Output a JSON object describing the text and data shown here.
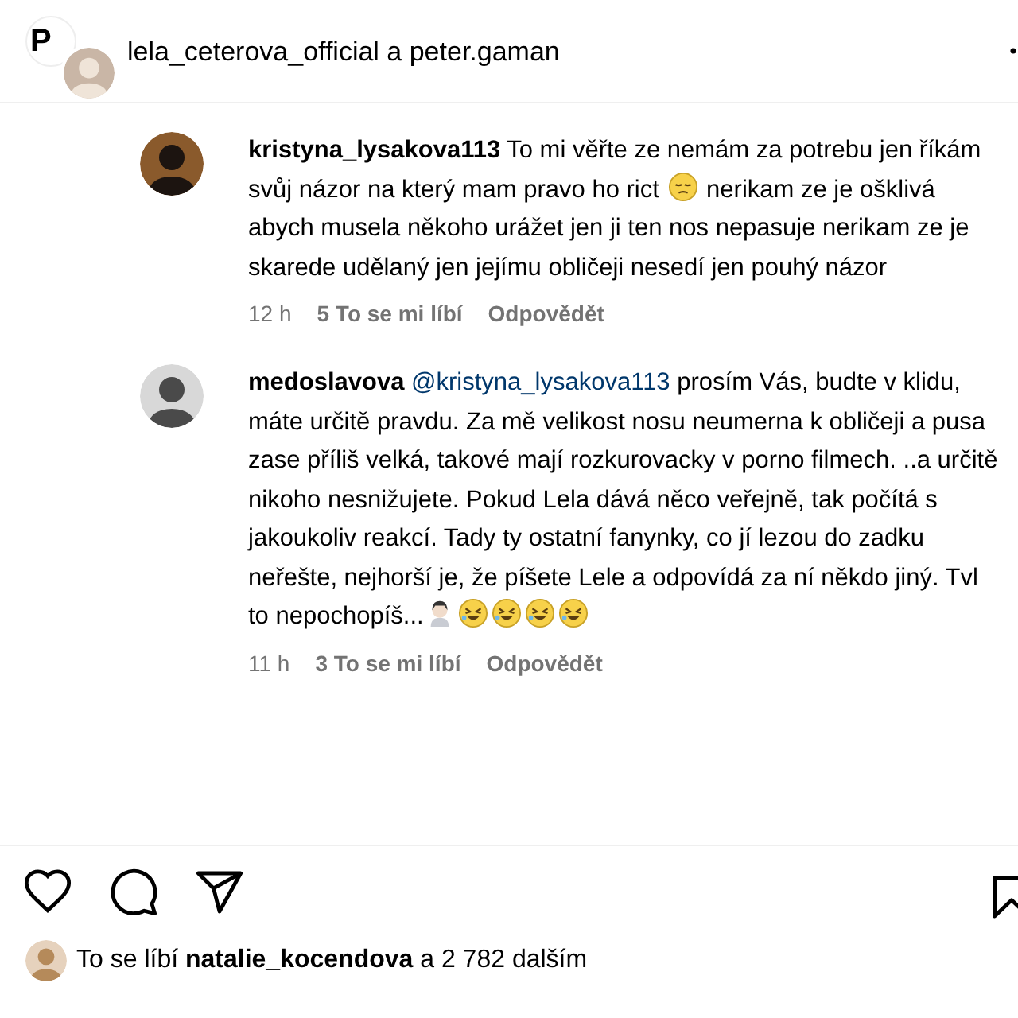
{
  "header": {
    "logo_text": "P",
    "title": "lela_ceterova_official a peter.gaman"
  },
  "comments": [
    {
      "username": "kristyna_lysakova113",
      "segments": [
        {
          "kind": "text",
          "text": "To mi věřte ze nemám za potrebu jen říkám svůj názor na který mam pravo ho rict "
        },
        {
          "kind": "emoji-pensive"
        },
        {
          "kind": "text",
          "text": " nerikam ze je ošklivá abych musela někoho urážet jen ji ten nos nepasuje nerikam ze je skarede udělaný jen jejímu obličeji nesedí jen pouhý názor"
        }
      ],
      "time": "12 h",
      "likes": "5 To se mi líbí",
      "reply": "Odpovědět"
    },
    {
      "username": "medoslavova",
      "mention": "@kristyna_lysakova113",
      "segments": [
        {
          "kind": "text",
          "text": "prosím Vás, budte v klidu, máte určitě pravdu. Za mě velikost nosu neumerna k obličeji a pusa zase příliš velká, takové mají rozkurovacky v porno filmech. ..a určitě nikoho nesnižujete. Pokud Lela dává něco veřejně, tak počítá s jakoukoliv reakcí. Tady ty ostatní fanynky, co jí lezou do zadku neřešte, nejhorší je, že píšete Lele a odpovídá za ní někdo jiný. Tvl to nepochopíš..."
        },
        {
          "kind": "emoji-person"
        },
        {
          "kind": "emoji-rofl"
        },
        {
          "kind": "emoji-rofl"
        },
        {
          "kind": "emoji-rofl"
        },
        {
          "kind": "emoji-rofl"
        }
      ],
      "time": "11 h",
      "likes": "3 To se mi líbí",
      "reply": "Odpovědět"
    }
  ],
  "likes": {
    "prefix": "To se líbí",
    "user": "natalie_kocendova",
    "suffix": "a 2 782 dalším"
  }
}
